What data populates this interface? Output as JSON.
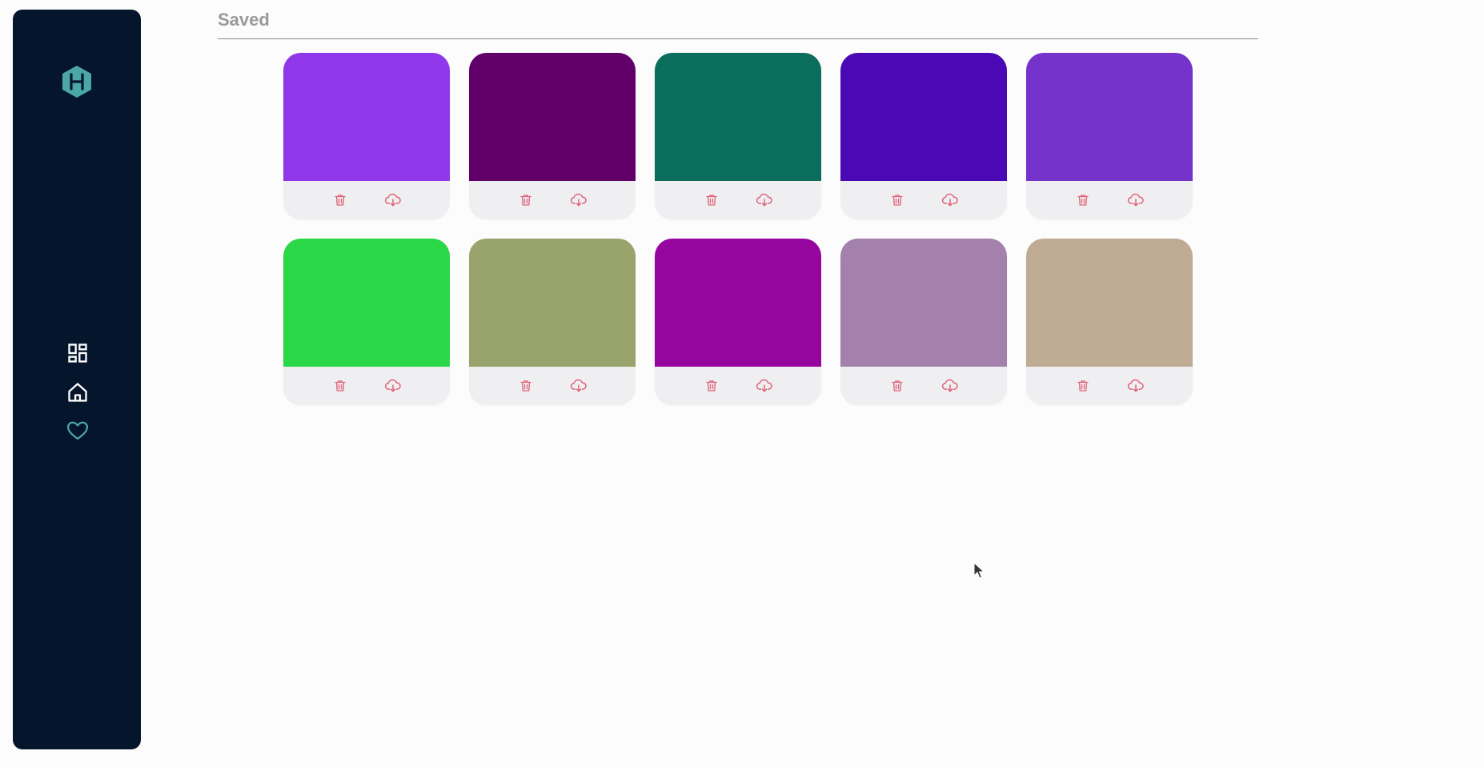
{
  "page": {
    "title": "Saved"
  },
  "sidebar": {
    "logo_icon": "hexagon-h-logo-icon",
    "items": [
      {
        "name": "dashboard",
        "icon": "dashboard-icon",
        "active": false
      },
      {
        "name": "home",
        "icon": "home-icon",
        "active": false
      },
      {
        "name": "saved",
        "icon": "heart-icon",
        "active": true
      }
    ]
  },
  "colors": {
    "sidebar_bg": "#05152b",
    "accent": "#4aa7a3",
    "nav_icon": "#ffffff",
    "action_icon": "#e0627a",
    "card_footer": "#efeff1"
  },
  "palettes": [
    {
      "color": "#9137ea"
    },
    {
      "color": "#62006a"
    },
    {
      "color": "#0b6e5c"
    },
    {
      "color": "#4a09b5"
    },
    {
      "color": "#7633cb"
    },
    {
      "color": "#2ad847"
    },
    {
      "color": "#98a46c"
    },
    {
      "color": "#94069e"
    },
    {
      "color": "#a480ac"
    },
    {
      "color": "#bfab94"
    }
  ],
  "card_actions": {
    "delete_icon": "trash-icon",
    "download_icon": "cloud-download-icon"
  }
}
